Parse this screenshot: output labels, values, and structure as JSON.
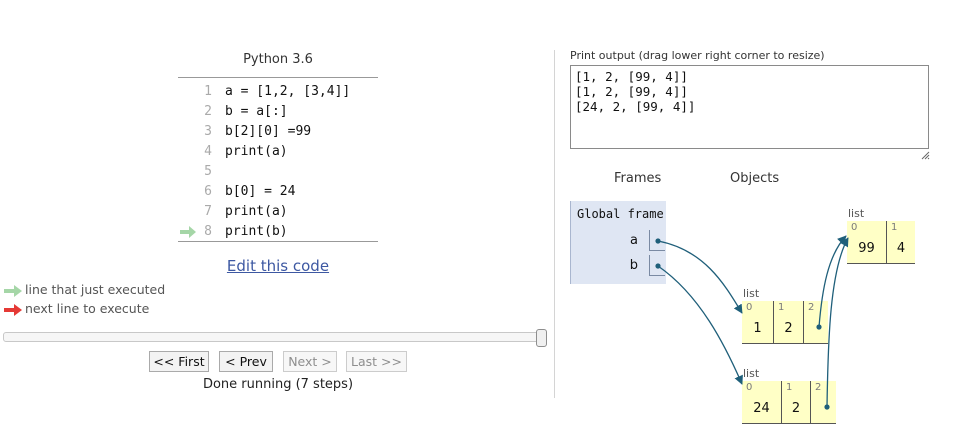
{
  "code": {
    "language": "Python 3.6",
    "lines": [
      {
        "no": "1",
        "text": "a = [1,2, [3,4]]"
      },
      {
        "no": "2",
        "text": "b = a[:]"
      },
      {
        "no": "3",
        "text": "b[2][0] =99"
      },
      {
        "no": "4",
        "text": "print(a)"
      },
      {
        "no": "5",
        "text": ""
      },
      {
        "no": "6",
        "text": "b[0] = 24"
      },
      {
        "no": "7",
        "text": "print(a)"
      },
      {
        "no": "8",
        "text": "print(b)"
      }
    ],
    "current_line": "8",
    "edit_link": "Edit this code"
  },
  "legend": {
    "green_label": "line that just executed",
    "red_label": "next line to execute",
    "green_color": "#a5d6a7",
    "red_color": "#e53935"
  },
  "navigation": {
    "first": "<< First",
    "prev": "< Prev",
    "next": "Next >",
    "last": "Last >>",
    "status": "Done running (7 steps)",
    "progress": 1.0
  },
  "output": {
    "label": "Print output (drag lower right corner to resize)",
    "lines": [
      "[1, 2, [99, 4]]",
      "[1, 2, [99, 4]]",
      "[24, 2, [99, 4]]"
    ]
  },
  "visualizer": {
    "frames_header": "Frames",
    "objects_header": "Objects",
    "global_frame": {
      "title": "Global frame",
      "vars": [
        {
          "name": "a"
        },
        {
          "name": "b"
        }
      ]
    },
    "objects": {
      "inner_list": {
        "type": "list",
        "items": [
          {
            "idx": "0",
            "val": "99"
          },
          {
            "idx": "1",
            "val": "4"
          }
        ]
      },
      "list_a": {
        "type": "list",
        "items": [
          {
            "idx": "0",
            "val": "1"
          },
          {
            "idx": "1",
            "val": "2"
          },
          {
            "idx": "2",
            "val": ""
          }
        ]
      },
      "list_b": {
        "type": "list",
        "items": [
          {
            "idx": "0",
            "val": "24"
          },
          {
            "idx": "1",
            "val": "2"
          },
          {
            "idx": "2",
            "val": ""
          }
        ]
      }
    },
    "arrow_color": "#1f5f7a",
    "heap_color": "#ffffc6",
    "frame_color": "#dfe6f3"
  }
}
